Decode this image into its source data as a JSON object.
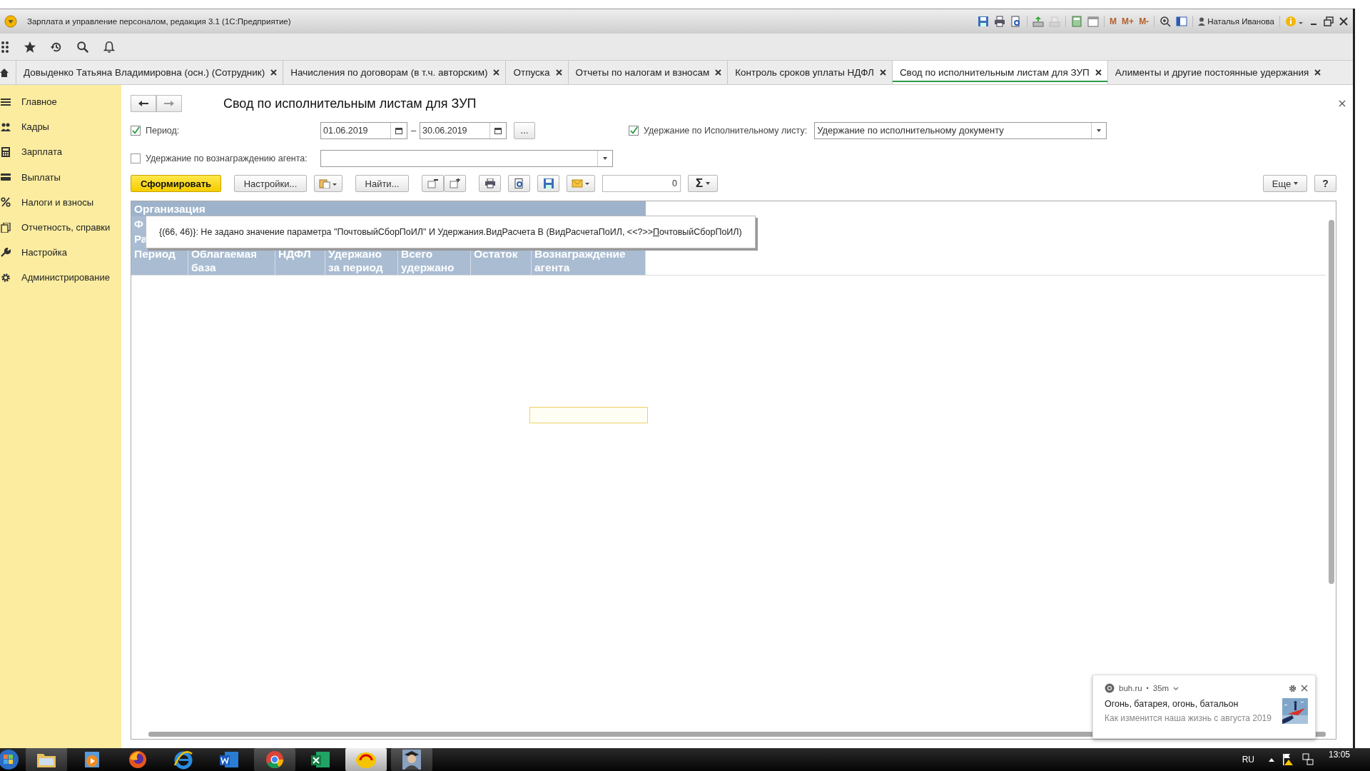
{
  "window": {
    "title": "Зарплата и управление персоналом, редакция 3.1  (1С:Предприятие)",
    "memory_buttons": [
      "M",
      "M+",
      "M-"
    ],
    "user": "Наталья Иванова"
  },
  "tabs": [
    {
      "label": "Довыденко Татьяна Владимировна  (осн.) (Сотрудник)",
      "selected": false
    },
    {
      "label": "Начисления по договорам (в т.ч. авторским)",
      "selected": false
    },
    {
      "label": "Отпуска",
      "selected": false
    },
    {
      "label": "Отчеты по налогам и взносам",
      "selected": false
    },
    {
      "label": "Контроль сроков уплаты НДФЛ",
      "selected": false
    },
    {
      "label": "Свод по исполнительным листам для ЗУП",
      "selected": true
    },
    {
      "label": "Алименты и другие постоянные удержания",
      "selected": false
    }
  ],
  "sidebar": {
    "items": [
      {
        "label": "Главное",
        "kind": "menu"
      },
      {
        "label": "Кадры",
        "kind": "people"
      },
      {
        "label": "Зарплата",
        "kind": "calc"
      },
      {
        "label": "Выплаты",
        "kind": "card"
      },
      {
        "label": "Налоги и взносы",
        "kind": "percent"
      },
      {
        "label": "Отчетность, справки",
        "kind": "docs"
      },
      {
        "label": "Настройка",
        "kind": "wrench"
      },
      {
        "label": "Администрирование",
        "kind": "gear"
      }
    ]
  },
  "form": {
    "title": "Свод по исполнительным листам для ЗУП",
    "period": {
      "label": "Период:",
      "checked": true,
      "from": "01.06.2019",
      "separator": "–",
      "to": "30.06.2019",
      "choose": "..."
    },
    "withholding": {
      "label": "Удержание по Исполнительному листу:",
      "checked": true,
      "value": "Удержание по исполнительному документу"
    },
    "agent": {
      "label": "Удержание по вознаграждению агента:",
      "checked": false
    },
    "generate": "Сформировать",
    "settings": "Настройки...",
    "find": "Найти...",
    "counter": "0",
    "sum": "Σ",
    "more": "Еще",
    "help": "?"
  },
  "report": {
    "group_header": "Организация",
    "partial_rows": [
      "Ф",
      "Ра"
    ],
    "columns": [
      "Период",
      "Облагаемая база",
      "НДФЛ",
      "Удержано за период",
      "Всего удержано",
      "Остаток",
      "Вознаграждение агента"
    ]
  },
  "tooltip": {
    "text_before": "{(66, 46)}: Не задано значение параметра \"ПочтовыйСборПоИЛ\" И Удержания.ВидРасчета В (ВидРасчетаПоИЛ, <<?>>",
    "underlined": "П",
    "text_after": "очтовыйСборПоИЛ)"
  },
  "notification": {
    "source": "buh.ru",
    "separator": "•",
    "age": "35m",
    "title": "Огонь, батарея, огонь, батальон",
    "body": "Как изменится наша жизнь с августа 2019"
  },
  "taskbar": {
    "language": "RU",
    "time": "13:05"
  }
}
